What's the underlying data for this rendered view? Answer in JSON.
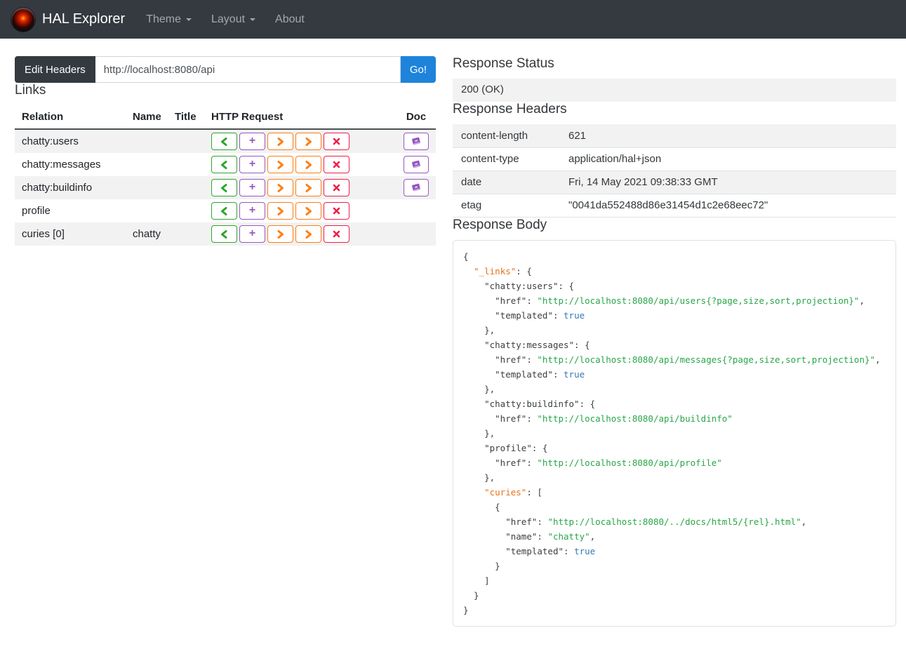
{
  "navbar": {
    "brand": "HAL Explorer",
    "items": [
      {
        "label": "Theme",
        "has_caret": true
      },
      {
        "label": "Layout",
        "has_caret": true
      },
      {
        "label": "About",
        "has_caret": false
      }
    ]
  },
  "request_bar": {
    "edit_headers_label": "Edit Headers",
    "url_value": "http://localhost:8080/api",
    "go_label": "Go!"
  },
  "links": {
    "title": "Links",
    "columns": [
      "Relation",
      "Name",
      "Title",
      "HTTP Request",
      "Doc"
    ],
    "http_buttons": [
      {
        "name": "http-get-button",
        "glyph": "chevron-left",
        "color": "#2fa52d"
      },
      {
        "name": "http-post-button",
        "glyph": "plus",
        "color": "#9857c2"
      },
      {
        "name": "http-put-button",
        "glyph": "chevron-right",
        "color": "#fd7e14"
      },
      {
        "name": "http-patch-button",
        "glyph": "chevron-right",
        "color": "#fd7e14"
      },
      {
        "name": "http-delete-button",
        "glyph": "x",
        "color": "#ef1e4c"
      }
    ],
    "rows": [
      {
        "relation": "chatty:users",
        "name": "",
        "title": "",
        "doc": true
      },
      {
        "relation": "chatty:messages",
        "name": "",
        "title": "",
        "doc": true
      },
      {
        "relation": "chatty:buildinfo",
        "name": "",
        "title": "",
        "doc": true
      },
      {
        "relation": "profile",
        "name": "",
        "title": "",
        "doc": false
      },
      {
        "relation": "curies [0]",
        "name": "chatty",
        "title": "",
        "doc": false
      }
    ]
  },
  "response_status": {
    "title": "Response Status",
    "value": "200 (OK)"
  },
  "response_headers": {
    "title": "Response Headers",
    "rows": [
      {
        "key": "content-length",
        "value": "621"
      },
      {
        "key": "content-type",
        "value": "application/hal+json"
      },
      {
        "key": "date",
        "value": "Fri, 14 May 2021 09:38:33 GMT"
      },
      {
        "key": "etag",
        "value": "\"0041da552488d86e31454d1c2e68eec72\""
      }
    ]
  },
  "response_body": {
    "title": "Response Body",
    "lines": [
      [
        {
          "c": "p",
          "t": "{"
        }
      ],
      [
        {
          "c": "p",
          "t": "  "
        },
        {
          "c": "o",
          "t": "\"_links\""
        },
        {
          "c": "p",
          "t": ": {"
        }
      ],
      [
        {
          "c": "p",
          "t": "    "
        },
        {
          "c": "k",
          "t": "\"chatty:users\""
        },
        {
          "c": "p",
          "t": ": {"
        }
      ],
      [
        {
          "c": "p",
          "t": "      "
        },
        {
          "c": "k",
          "t": "\"href\""
        },
        {
          "c": "p",
          "t": ": "
        },
        {
          "c": "s",
          "t": "\"http://localhost:8080/api/users{?page,size,sort,projection}\""
        },
        {
          "c": "p",
          "t": ","
        }
      ],
      [
        {
          "c": "p",
          "t": "      "
        },
        {
          "c": "k",
          "t": "\"templated\""
        },
        {
          "c": "p",
          "t": ": "
        },
        {
          "c": "b",
          "t": "true"
        }
      ],
      [
        {
          "c": "p",
          "t": "    },"
        }
      ],
      [
        {
          "c": "p",
          "t": "    "
        },
        {
          "c": "k",
          "t": "\"chatty:messages\""
        },
        {
          "c": "p",
          "t": ": {"
        }
      ],
      [
        {
          "c": "p",
          "t": "      "
        },
        {
          "c": "k",
          "t": "\"href\""
        },
        {
          "c": "p",
          "t": ": "
        },
        {
          "c": "s",
          "t": "\"http://localhost:8080/api/messages{?page,size,sort,projection}\""
        },
        {
          "c": "p",
          "t": ","
        }
      ],
      [
        {
          "c": "p",
          "t": "      "
        },
        {
          "c": "k",
          "t": "\"templated\""
        },
        {
          "c": "p",
          "t": ": "
        },
        {
          "c": "b",
          "t": "true"
        }
      ],
      [
        {
          "c": "p",
          "t": "    },"
        }
      ],
      [
        {
          "c": "p",
          "t": "    "
        },
        {
          "c": "k",
          "t": "\"chatty:buildinfo\""
        },
        {
          "c": "p",
          "t": ": {"
        }
      ],
      [
        {
          "c": "p",
          "t": "      "
        },
        {
          "c": "k",
          "t": "\"href\""
        },
        {
          "c": "p",
          "t": ": "
        },
        {
          "c": "s",
          "t": "\"http://localhost:8080/api/buildinfo\""
        }
      ],
      [
        {
          "c": "p",
          "t": "    },"
        }
      ],
      [
        {
          "c": "p",
          "t": "    "
        },
        {
          "c": "k",
          "t": "\"profile\""
        },
        {
          "c": "p",
          "t": ": {"
        }
      ],
      [
        {
          "c": "p",
          "t": "      "
        },
        {
          "c": "k",
          "t": "\"href\""
        },
        {
          "c": "p",
          "t": ": "
        },
        {
          "c": "s",
          "t": "\"http://localhost:8080/api/profile\""
        }
      ],
      [
        {
          "c": "p",
          "t": "    },"
        }
      ],
      [
        {
          "c": "p",
          "t": "    "
        },
        {
          "c": "o",
          "t": "\"curies\""
        },
        {
          "c": "p",
          "t": ": ["
        }
      ],
      [
        {
          "c": "p",
          "t": "      {"
        }
      ],
      [
        {
          "c": "p",
          "t": "        "
        },
        {
          "c": "k",
          "t": "\"href\""
        },
        {
          "c": "p",
          "t": ": "
        },
        {
          "c": "s",
          "t": "\"http://localhost:8080/../docs/html5/{rel}.html\""
        },
        {
          "c": "p",
          "t": ","
        }
      ],
      [
        {
          "c": "p",
          "t": "        "
        },
        {
          "c": "k",
          "t": "\"name\""
        },
        {
          "c": "p",
          "t": ": "
        },
        {
          "c": "s",
          "t": "\"chatty\""
        },
        {
          "c": "p",
          "t": ","
        }
      ],
      [
        {
          "c": "p",
          "t": "        "
        },
        {
          "c": "k",
          "t": "\"templated\""
        },
        {
          "c": "p",
          "t": ": "
        },
        {
          "c": "b",
          "t": "true"
        }
      ],
      [
        {
          "c": "p",
          "t": "      }"
        }
      ],
      [
        {
          "c": "p",
          "t": "    ]"
        }
      ],
      [
        {
          "c": "p",
          "t": "  }"
        }
      ],
      [
        {
          "c": "p",
          "t": "}"
        }
      ]
    ]
  },
  "colors": {
    "navbar_bg": "#343a40",
    "go_button": "#1e83db",
    "stripe": "#f2f2f2",
    "doc_purple": "#9857c2",
    "token_punct": "#3b3e42",
    "token_key": "#3b3e42",
    "token_special_key": "#e8721c",
    "token_string": "#28a647",
    "token_bool": "#3579bb"
  }
}
